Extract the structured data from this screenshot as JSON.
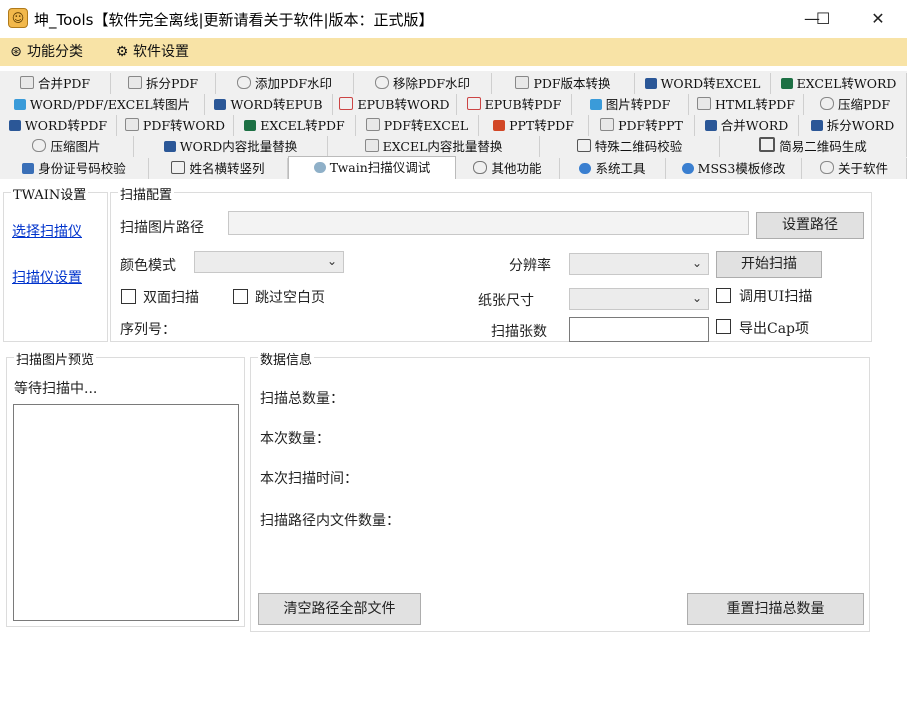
{
  "window": {
    "title": "坤_Tools【软件完全离线|更新请看关于软件|版本：正式版】",
    "minimize": "—",
    "maximize": "☐",
    "close": "✕"
  },
  "menu": {
    "category": "功能分类",
    "settings": "软件设置"
  },
  "tabs": {
    "row1": [
      "合并PDF",
      "拆分PDF",
      "添加PDF水印",
      "移除PDF水印",
      "PDF版本转换",
      "WORD转EXCEL",
      "EXCEL转WORD"
    ],
    "row2": [
      "WORD/PDF/EXCEL转图片",
      "WORD转EPUB",
      "EPUB转WORD",
      "EPUB转PDF",
      "图片转PDF",
      "HTML转PDF",
      "压缩PDF"
    ],
    "row3": [
      "WORD转PDF",
      "PDF转WORD",
      "EXCEL转PDF",
      "PDF转EXCEL",
      "PPT转PDF",
      "PDF转PPT",
      "合并WORD",
      "拆分WORD"
    ],
    "row4": [
      "压缩图片",
      "WORD内容批量替换",
      "EXCEL内容批量替换",
      "特殊二维码校验",
      "简易二维码生成"
    ],
    "row5": [
      "身份证号码校验",
      "姓名横转竖列",
      "Twain扫描仪调试",
      "其他功能",
      "系统工具",
      "MSS3模板修改",
      "关于软件"
    ]
  },
  "twain": {
    "group_title": "TWAIN设置",
    "select_scanner": "选择扫描仪",
    "scanner_settings": "扫描仪设置"
  },
  "scan_config": {
    "group_title": "扫描配置",
    "path_label": "扫描图片路径",
    "set_path_button": "设置路径",
    "color_mode_label": "颜色模式",
    "resolution_label": "分辨率",
    "start_scan_button": "开始扫描",
    "duplex_label": "双面扫描",
    "skip_blank_label": "跳过空白页",
    "paper_size_label": "纸张尺寸",
    "use_ui_label": "调用UI扫描",
    "serial_label": "序列号：",
    "scan_count_label": "扫描张数",
    "export_cap_label": "导出Cap项"
  },
  "preview": {
    "group_title": "扫描图片预览",
    "status": "等待扫描中..."
  },
  "data_info": {
    "group_title": "数据信息",
    "total_count": "扫描总数量：",
    "this_count": "本次数量：",
    "this_time": "本次扫描时间：",
    "files_in_path": "扫描路径内文件数量：",
    "clear_button": "清空路径全部文件",
    "reset_button": "重置扫描总数量"
  }
}
